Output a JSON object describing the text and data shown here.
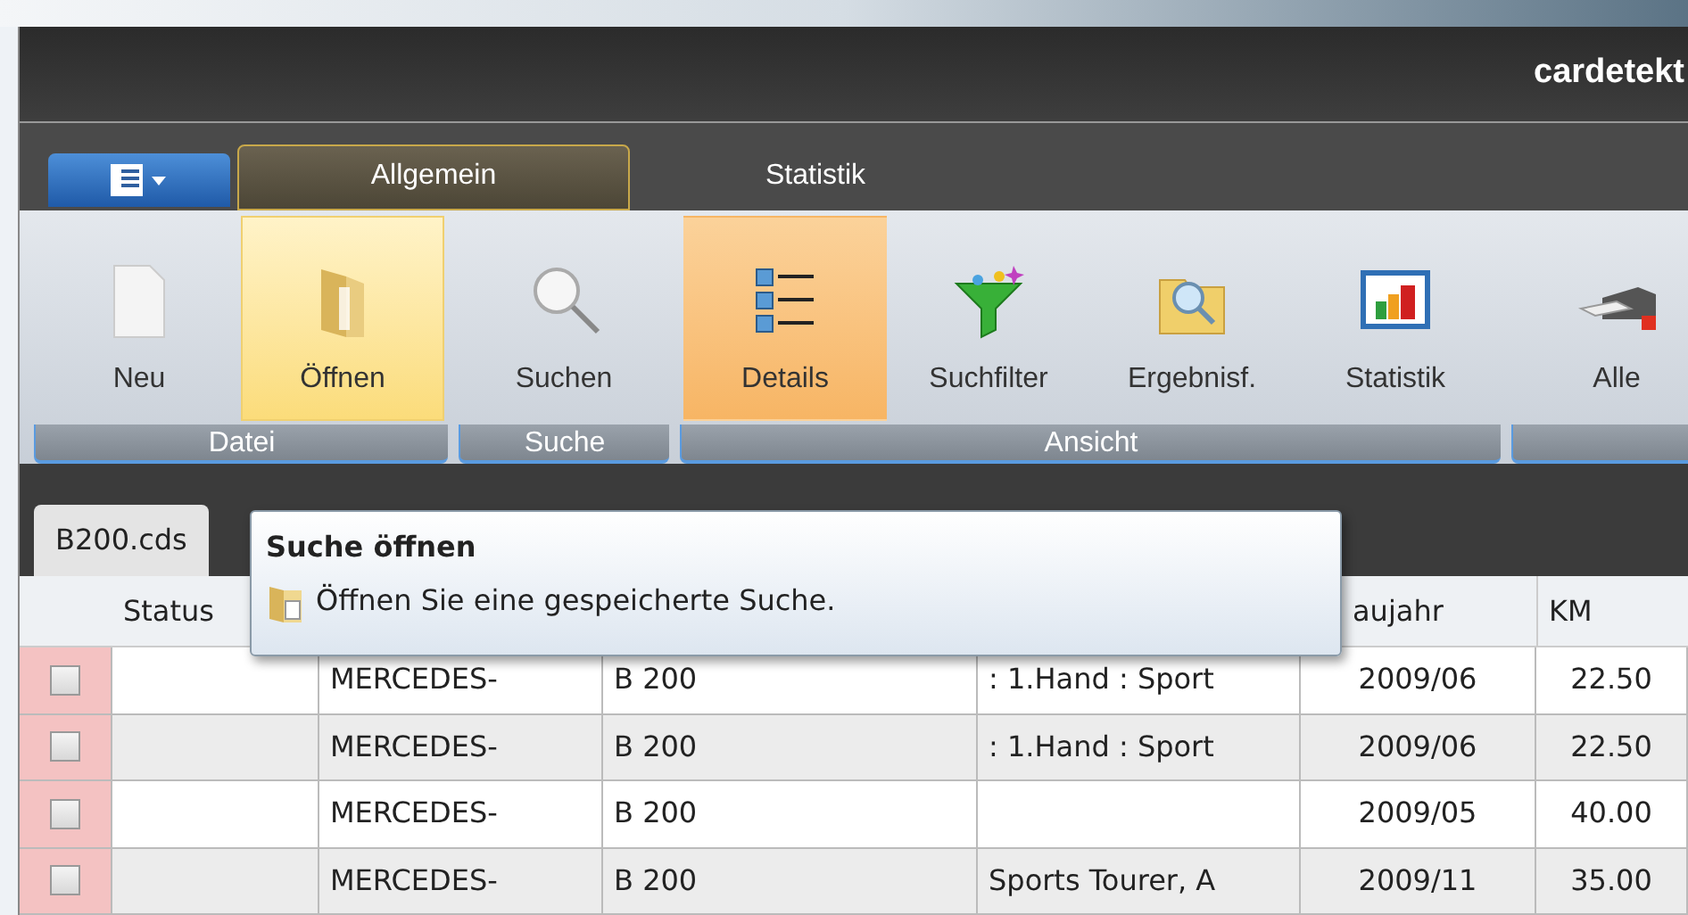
{
  "window": {
    "title": "cardetekt"
  },
  "tabs": [
    {
      "label": "Allgemein",
      "selected": true
    },
    {
      "label": "Statistik",
      "selected": false
    }
  ],
  "ribbon_groups": [
    {
      "label": "Datei",
      "buttons": [
        {
          "label": "Neu",
          "kind": "page",
          "selected": false,
          "hovered": false
        },
        {
          "label": "Öffnen",
          "kind": "folder",
          "selected": false,
          "hovered": true
        }
      ]
    },
    {
      "label": "Suche",
      "buttons": [
        {
          "label": "Suchen",
          "kind": "magnifier",
          "selected": false,
          "hovered": false
        }
      ]
    },
    {
      "label": "Ansicht",
      "buttons": [
        {
          "label": "Details",
          "kind": "list",
          "selected": true,
          "hovered": false
        },
        {
          "label": "Suchfilter",
          "kind": "funnel",
          "selected": false,
          "hovered": false
        },
        {
          "label": "Ergebnisf.",
          "kind": "search-folder",
          "selected": false,
          "hovered": false
        },
        {
          "label": "Statistik",
          "kind": "chart",
          "selected": false,
          "hovered": false
        }
      ]
    },
    {
      "buttons": [
        {
          "label": "Alle",
          "kind": "printer",
          "selected": false,
          "hovered": false
        }
      ]
    }
  ],
  "document_tabs": [
    {
      "label": "B200.cds",
      "selected": true
    }
  ],
  "table": {
    "columns": {
      "status": "Status",
      "baujahr": "aujahr",
      "km": "KM"
    },
    "rows": [
      {
        "checked": false,
        "column_3": "MERCEDES-",
        "column_4": "B 200",
        "column_5": ": 1.Hand : Sport",
        "baujahr": "2009/06",
        "km": "22.50"
      },
      {
        "checked": false,
        "column_3": "MERCEDES-",
        "column_4": "B 200",
        "column_5": ": 1.Hand : Sport",
        "baujahr": "2009/06",
        "km": "22.50"
      },
      {
        "checked": false,
        "column_3": "MERCEDES-",
        "column_4": "B 200",
        "baujahr": "2009/05",
        "km": "40.00"
      },
      {
        "checked": false,
        "column_3": "MERCEDES-",
        "column_4": "B 200",
        "column_5": "Sports Tourer, A",
        "baujahr": "2009/11",
        "km": "35.00"
      }
    ]
  },
  "tooltip": {
    "title": "Suche öffnen",
    "text": "Öffnen Sie eine gespeicherte Suche."
  }
}
